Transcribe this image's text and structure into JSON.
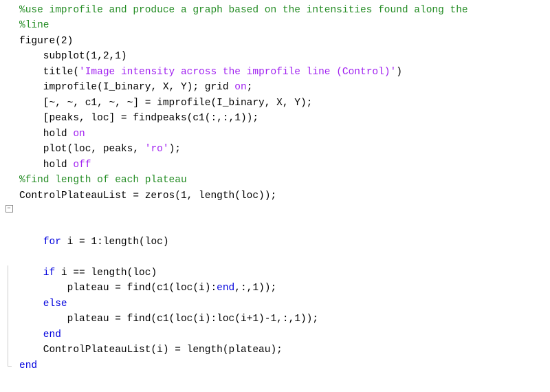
{
  "code": {
    "l1": "%use improfile and produce a graph based on the intensities found along the",
    "l2": "%line",
    "l3a": "figure",
    "l3b": "(2)",
    "l4a": "    subplot",
    "l4b": "(1,2,1)",
    "l5a": "    title",
    "l5b": "(",
    "l5c": "'Image intensity across the improfile line (Control)'",
    "l5d": ")",
    "l6a": "    improfile",
    "l6b": "(I_binary, X, Y); ",
    "l6c": "grid",
    "l6d": " ",
    "l6e": "on",
    "l6f": ";",
    "l7": "    [~, ~, c1, ~, ~] = improfile(I_binary, X, Y);",
    "l8": "    [peaks, loc] = findpeaks(c1(:,:,1));",
    "l9a": "    hold",
    "l9b": " ",
    "l9c": "on",
    "l10a": "    plot",
    "l10b": "(loc, peaks, ",
    "l10c": "'ro'",
    "l10d": ");",
    "l11a": "    hold",
    "l11b": " ",
    "l11c": "off",
    "l12": "",
    "l13": "%find length of each plateau",
    "l14": "ControlPlateauList = zeros(1, length(loc));",
    "l15": "",
    "l16a": "for",
    "l16b": " i = 1:length(loc)",
    "l17a": "    if",
    "l17b": " i == length(loc)",
    "l18a": "        plateau = find(c1(loc(i):",
    "l18b": "end",
    "l18c": ",:,1));",
    "l19": "    else",
    "l20": "        plateau = find(c1(loc(i):loc(i+1)-1,:,1));",
    "l21": "    end",
    "l22": "    ControlPlateauList(i) = length(plateau);",
    "l23": "end"
  }
}
